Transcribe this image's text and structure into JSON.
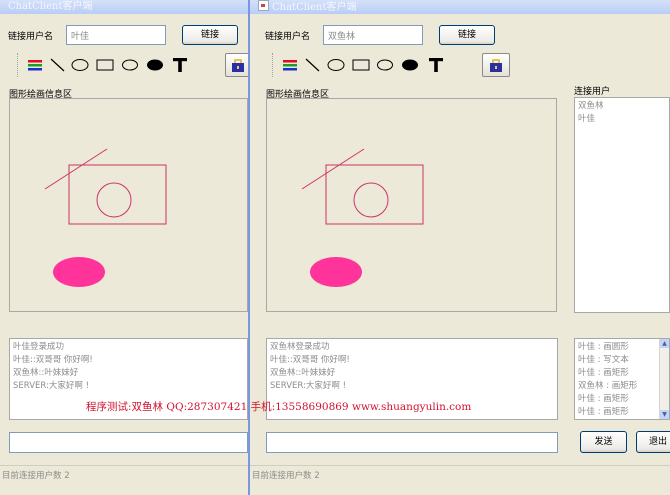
{
  "colors": {
    "title_gradient_top": "#D5E1FA",
    "drawing_stroke": "#CC3366",
    "ellipse_fill": "#FF3399",
    "watermark": "#D2122E"
  },
  "left_window": {
    "title": "ChatClient客户端",
    "username_label": "链接用户名",
    "username_value": "叶佳",
    "connect_button": "链接",
    "drawing_area_label": "图形绘画信息区",
    "chat_log": [
      "叶佳登录成功",
      "叶佳::双哥哥 你好啊!",
      "双鱼林::叶妹妹好",
      "SERVER:大家好啊 !"
    ],
    "message_input": "",
    "status": "目前连接用户数  2"
  },
  "right_window": {
    "title": "ChatClient客户端",
    "username_label": "链接用户名",
    "username_value": "双鱼林",
    "connect_button": "链接",
    "drawing_area_label": "图形绘画信息区",
    "users_label": "连接用户",
    "users": [
      "双鱼林",
      "叶佳"
    ],
    "chat_log": [
      "双鱼林登录成功",
      "叶佳::双哥哥 你好啊!",
      "双鱼林::叶妹妹好",
      "SERVER:大家好啊 !"
    ],
    "action_log": [
      "叶佳 : 画圆形",
      "叶佳 : 写文本",
      "叶佳 : 画矩形",
      "双鱼林 : 画矩形",
      "叶佳 : 画矩形",
      "叶佳 : 画矩形"
    ],
    "message_input": "",
    "send_button": "发送",
    "exit_button": "退出",
    "status": "目前连接用户数  2"
  },
  "tools": [
    {
      "icon": "color-picker-icon"
    },
    {
      "icon": "line-tool-icon"
    },
    {
      "icon": "circle-tool-icon"
    },
    {
      "icon": "rectangle-tool-icon"
    },
    {
      "icon": "oval-tool-icon"
    },
    {
      "icon": "filled-oval-tool-icon"
    },
    {
      "icon": "text-tool-icon"
    },
    {
      "icon": "clear-bag-icon"
    }
  ],
  "watermark": "程序测试:双鱼林 QQ:287307421 手机:13558690869 www.shuangyulin.com"
}
